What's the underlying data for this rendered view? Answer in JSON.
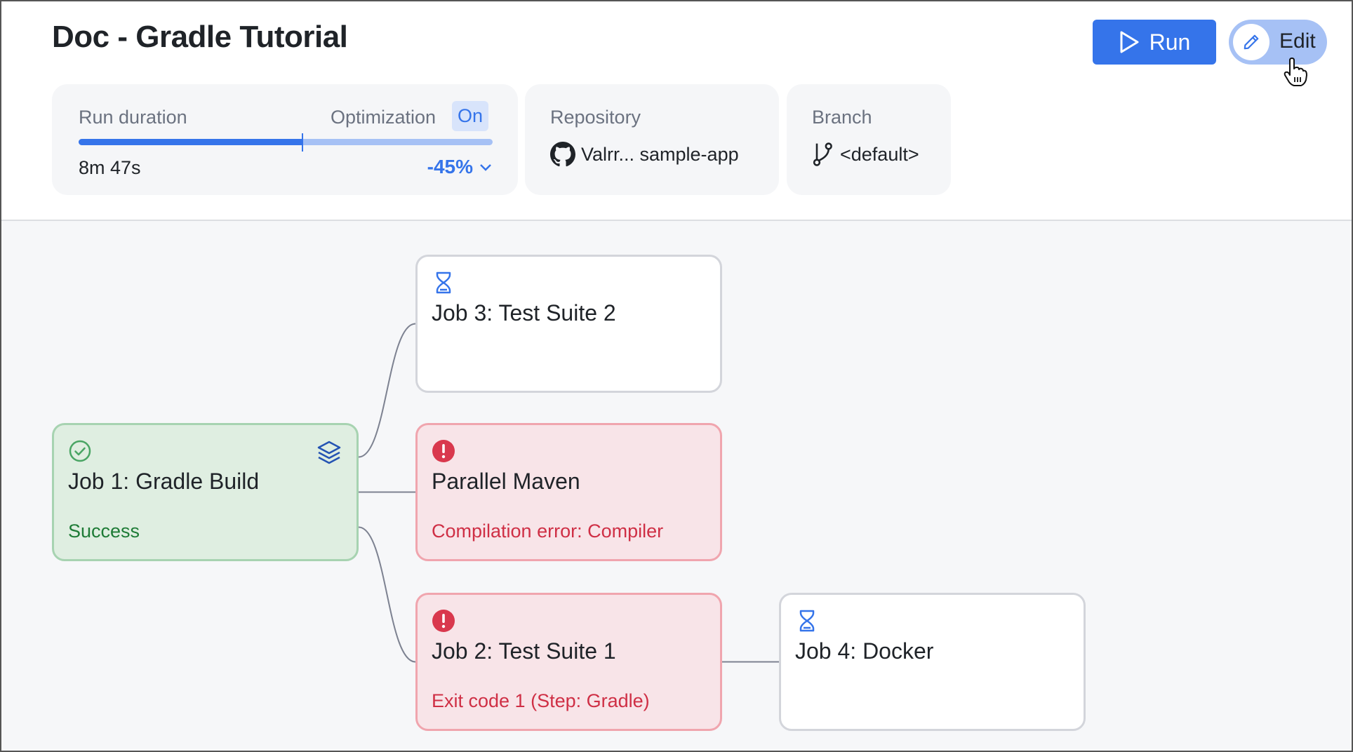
{
  "header": {
    "title": "Doc - Gradle Tutorial",
    "run_label": "Run",
    "edit_label": "Edit"
  },
  "summary": {
    "duration": {
      "label": "Run duration",
      "value": "8m 47s",
      "optimization_label": "Optimization",
      "optimization_state": "On",
      "reduction": "-45%",
      "progress_fraction": 0.54
    },
    "repository": {
      "label": "Repository",
      "value": "Valrr... sample-app",
      "icon": "github-icon"
    },
    "branch": {
      "label": "Branch",
      "value": "<default>",
      "icon": "git-branch-icon"
    }
  },
  "colors": {
    "accent": "#3574ea",
    "success": "#1e7b36",
    "error": "#cf2f45"
  },
  "pipeline": {
    "jobs": [
      {
        "id": "job1",
        "name": "Job 1: Gradle Build",
        "status": "success",
        "message": "Success",
        "icon": "check-circle-icon",
        "extra_icon": "layers-icon"
      },
      {
        "id": "job3",
        "name": "Job 3: Test Suite 2",
        "status": "pending",
        "message": "",
        "icon": "hourglass-icon"
      },
      {
        "id": "maven",
        "name": "Parallel Maven",
        "status": "error",
        "message": "Compilation error: Compiler",
        "icon": "error-circle-icon"
      },
      {
        "id": "job2",
        "name": "Job 2: Test Suite 1",
        "status": "error",
        "message": "Exit code 1 (Step: Gradle)",
        "icon": "error-circle-icon"
      },
      {
        "id": "job4",
        "name": "Job 4: Docker",
        "status": "pending",
        "message": "",
        "icon": "hourglass-icon"
      }
    ],
    "edges": [
      {
        "from": "job1",
        "to": "job3"
      },
      {
        "from": "job1",
        "to": "maven"
      },
      {
        "from": "job1",
        "to": "job2"
      },
      {
        "from": "job2",
        "to": "job4"
      }
    ]
  }
}
